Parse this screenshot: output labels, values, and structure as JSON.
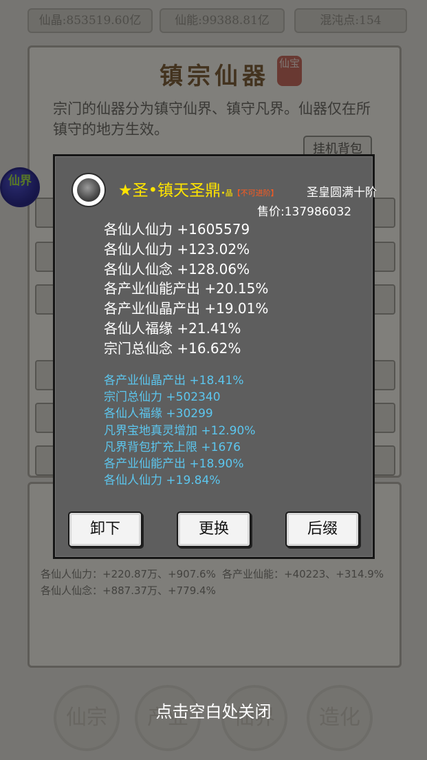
{
  "top_bar": {
    "crystal": "仙晶:853519.60亿",
    "energy": "仙能:99388.81亿",
    "chaos": "混沌点:154"
  },
  "panel": {
    "title": "镇宗仙器",
    "seal": "仙宝",
    "description": "宗门的仙器分为镇守仙界、镇守凡界。仙器仅在所镇守的地方生效。",
    "bag_button": "挂机背包"
  },
  "side_badge": {
    "label": "仙界"
  },
  "bottom_panel": {
    "line1": "各仙人仙力：+220.87万、+907.6%",
    "line2": "各产业仙能：+40223、+314.9%",
    "line3": "各仙人仙念：+887.37万、+779.4%"
  },
  "nav": [
    "仙宗",
    "产业",
    "仙界",
    "造化"
  ],
  "close_hint": "点击空白处关闭",
  "dialog": {
    "icon": "cauldron-icon",
    "name_prefix": "★圣•镇天圣鼎",
    "name_small": "•晶",
    "name_tag": "【不可进阶】",
    "rank": "圣皇圆满十阶",
    "price": "售价:137986032",
    "main_attrs": [
      "各仙人仙力 +1605579",
      "各仙人仙力 +123.02%",
      "各仙人仙念 +128.06%",
      "各产业仙能产出 +20.15%",
      "各产业仙晶产出 +19.01%",
      "各仙人福缘 +21.41%",
      "宗门总仙念 +16.62%"
    ],
    "suffix_attrs": [
      "各产业仙晶产出 +18.41%",
      "宗门总仙力 +502340",
      "各仙人福缘 +30299",
      "凡界宝地真灵增加 +12.90%",
      "凡界背包扩充上限 +1676",
      "各产业仙能产出 +18.90%",
      "各仙人仙力 +19.84%"
    ],
    "buttons": {
      "unequip": "卸下",
      "replace": "更换",
      "suffix": "后缀"
    }
  }
}
